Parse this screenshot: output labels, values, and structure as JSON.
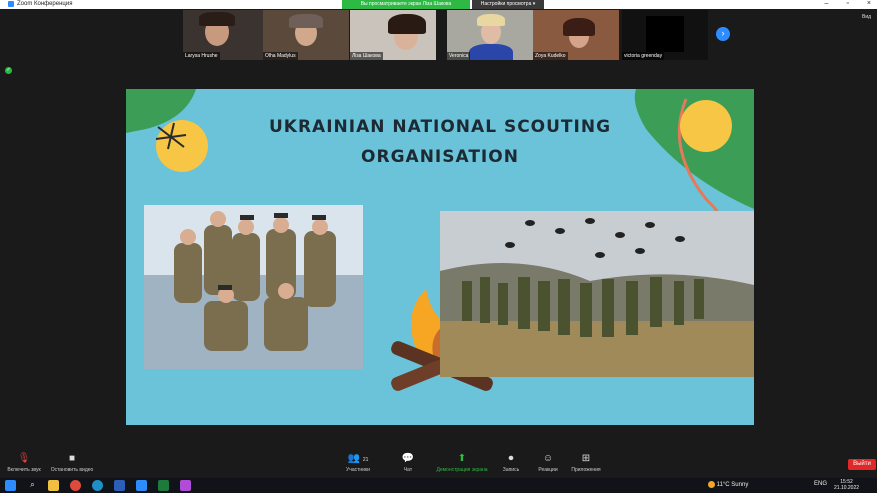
{
  "window": {
    "title": "Zoom Конференция",
    "viewing_banner": "Вы просматриваете экран Ліза Шакова",
    "view_options": "Настройки просмотра"
  },
  "participants": [
    {
      "name": "Larysa Hrushe"
    },
    {
      "name": "Olha Madylus"
    },
    {
      "name": "Ліза Шакова"
    },
    {
      "name": "Veronica"
    },
    {
      "name": "Zoya Kudelko"
    },
    {
      "name": "victoria greenday"
    }
  ],
  "side_label": "Вид",
  "slide": {
    "title_line1": "UKRAINIAN NATIONAL SCOUTING",
    "title_line2": "ORGANISATION"
  },
  "toolbar": {
    "mute": "Включить звук",
    "video": "Остановить видео",
    "participants": "Участники",
    "participants_count": "21",
    "chat": "Чат",
    "share": "Демонстрация экрана",
    "record": "Запись",
    "reactions": "Реакции",
    "apps": "Приложения",
    "leave": "Выйти"
  },
  "taskbar": {
    "weather": "11°C  Sunny",
    "lang": "ENG",
    "time": "15:52",
    "date": "21.10.2022"
  },
  "colors": {
    "slide_bg": "#6ac3d9",
    "accent_green": "#2db944",
    "zoom_blue": "#2d8cff",
    "leave_red": "#e02828",
    "sun_yellow": "#f6c644",
    "leaf_green": "#3c9e56"
  }
}
